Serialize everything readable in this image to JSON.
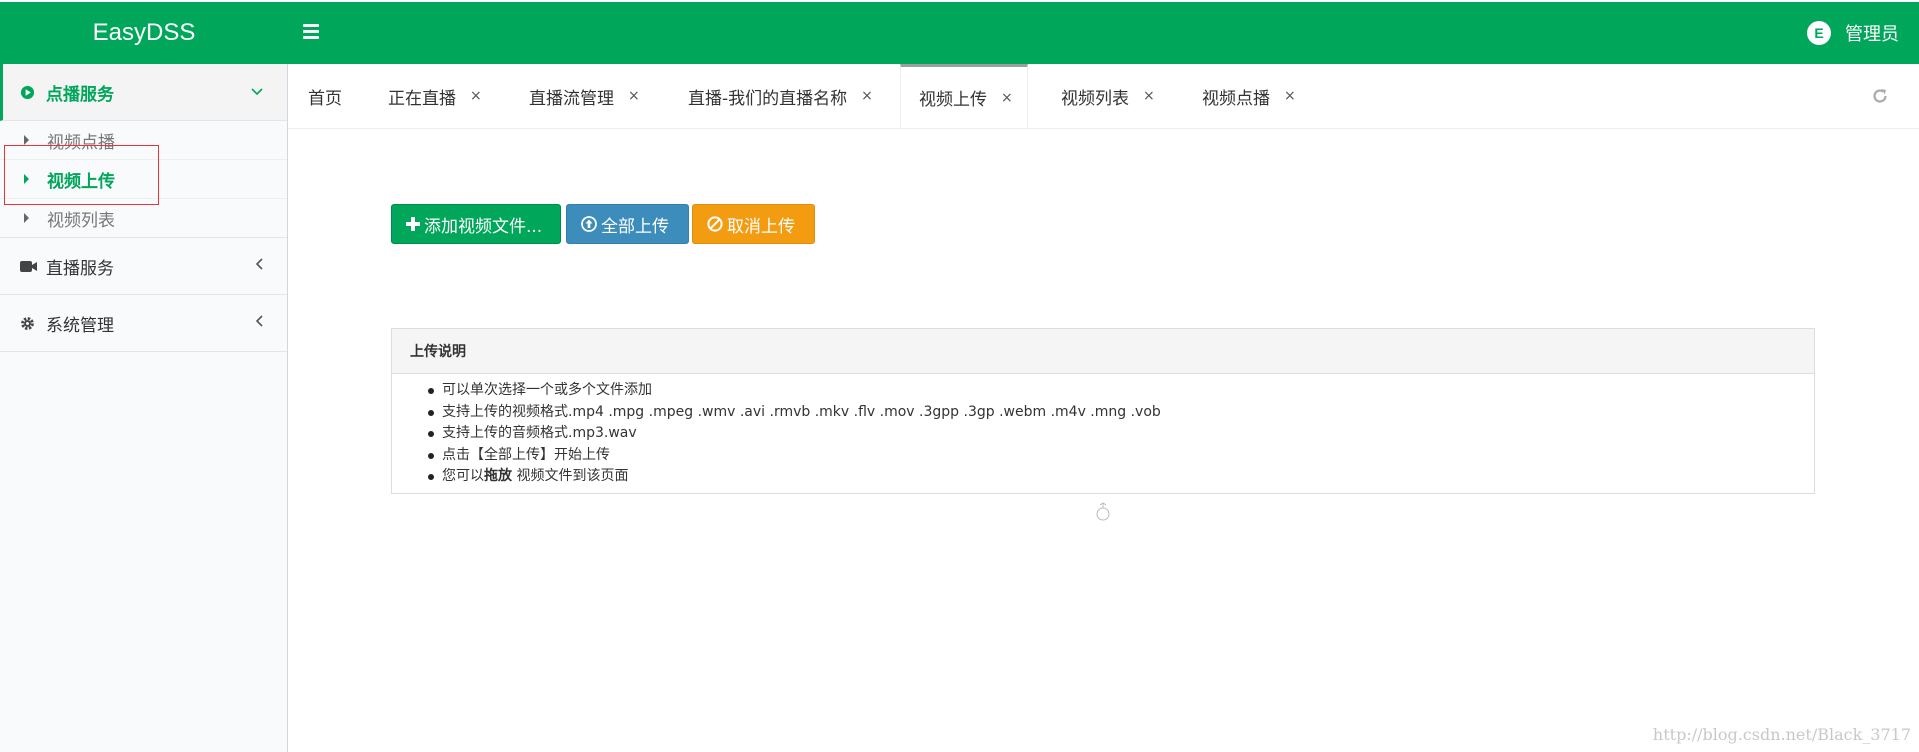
{
  "header": {
    "logo": "EasyDSS",
    "user_name": "管理员",
    "avatar_letter": "E",
    "color": "#00a65a"
  },
  "sidebar": {
    "groups": [
      {
        "label": "点播服务",
        "icon": "play-circle-icon",
        "active": true,
        "items": [
          {
            "label": "视频点播",
            "active": false
          },
          {
            "label": "视频上传",
            "active": true
          },
          {
            "label": "视频列表",
            "active": false
          }
        ]
      },
      {
        "label": "直播服务",
        "icon": "video-camera-icon",
        "active": false
      },
      {
        "label": "系统管理",
        "icon": "gear-icon",
        "active": false
      }
    ]
  },
  "tabs": [
    {
      "label": "首页",
      "closable": false
    },
    {
      "label": "正在直播",
      "closable": true
    },
    {
      "label": "直播流管理",
      "closable": true
    },
    {
      "label": "直播-我们的直播名称",
      "closable": true
    },
    {
      "label": "视频上传",
      "closable": true,
      "active": true
    },
    {
      "label": "视频列表",
      "closable": true
    },
    {
      "label": "视频点播",
      "closable": true
    }
  ],
  "tab_close": "×",
  "buttons": {
    "add": "添加视频文件...",
    "upload_all": "全部上传",
    "cancel": "取消上传"
  },
  "panel": {
    "title": "上传说明",
    "items": [
      "可以单次选择一个或多个文件添加",
      "支持上传的视频格式.mp4 .mpg .mpeg .wmv .avi .rmvb .mkv .flv .mov .3gpp .3gp .webm .m4v .mng .vob",
      "支持上传的音频格式.mp3.wav",
      "点击【全部上传】开始上传"
    ],
    "drag_prefix": "您可以",
    "drag_bold": "拖放",
    "drag_suffix": " 视频文件到该页面"
  },
  "watermark": "http://blog.csdn.net/Black_3717"
}
